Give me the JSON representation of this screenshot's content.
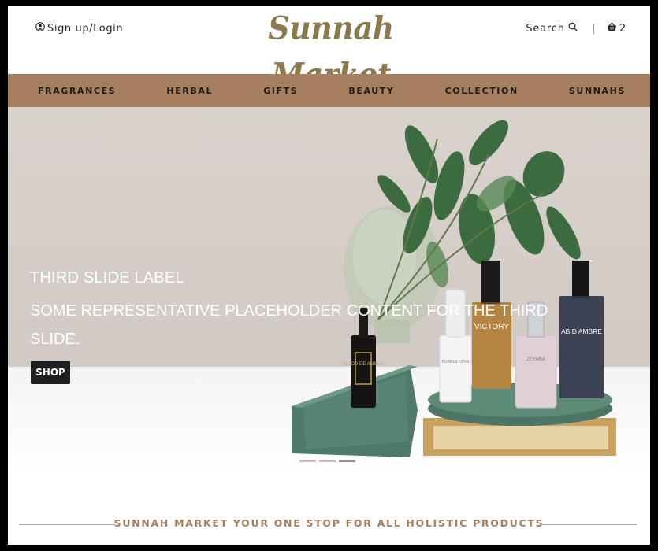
{
  "header": {
    "login_label": "Sign up/Login",
    "logo_text": "Sunnah Market",
    "search_label": "Search",
    "separator": "|",
    "cart_count": "2"
  },
  "nav": {
    "items": [
      "FRAGRANCES",
      "HERBAL",
      "GIFTS",
      "BEAUTY",
      "COLLECTION",
      "SUNNAHS"
    ]
  },
  "hero": {
    "label": "THIRD SLIDE LABEL",
    "text": "SOME REPRESENTATIVE PLACEHOLDER CONTENT FOR THE THIRD SLIDE.",
    "button_label": "SHOP",
    "slide_count": 3,
    "active_slide": 3,
    "products": {
      "bottle1": "WOOD DE AMBER",
      "bottle2": "PURPLE LOVE",
      "bottle3": "VICTORY",
      "bottle4": "ZEYARA",
      "bottle5": "ABID AMBRE"
    }
  },
  "footer": {
    "tagline": "SUNNAH MARKET YOUR ONE STOP FOR ALL HOLISTIC PRODUCTS"
  },
  "colors": {
    "nav_bg": "#a57f5e",
    "logo": "#8a7a4e",
    "tagline": "#a57f5e"
  }
}
